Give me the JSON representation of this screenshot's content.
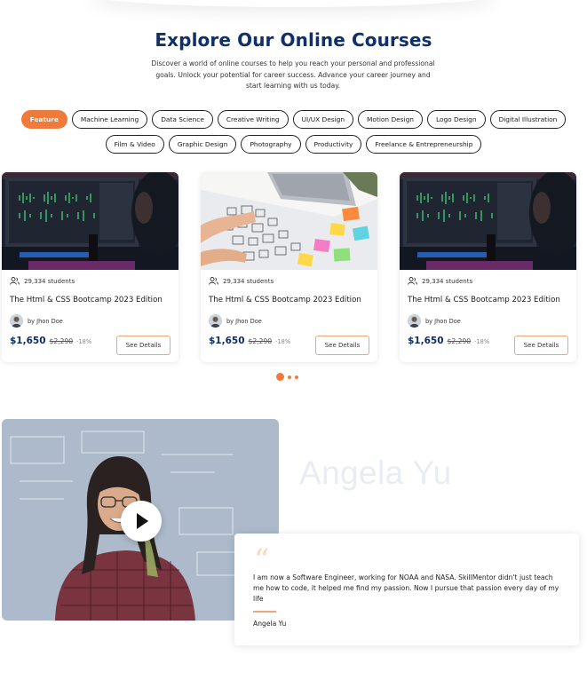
{
  "section": {
    "title": "Explore Our Online Courses",
    "subtitle": "Discover a world of online courses to help you reach your personal and professional goals. Unlock your potential for career success. Advance your career journey and start learning with us today."
  },
  "categories": {
    "row1": [
      "Feature",
      "Machine Learning",
      "Data Science",
      "Creative Writing",
      "UI/UX Design",
      "Motion Design",
      "Logo Design",
      "Digital Illustration"
    ],
    "row2": [
      "Film & Video",
      "Graphic Design",
      "Photography",
      "Productivity",
      "Freelance & Entrepreneurship"
    ],
    "active": "Feature"
  },
  "courses": [
    {
      "students": "29,334 students",
      "title": "The Html & CSS Bootcamp 2023 Edition",
      "author": "by Jhon Doe",
      "price": "$1,650",
      "old_price": "$2,290",
      "discount": "-18%",
      "button": "See Details",
      "image": "audio-editing-setup"
    },
    {
      "students": "29,334 students",
      "title": "The Html & CSS Bootcamp 2023 Edition",
      "author": "by Jhon Doe",
      "price": "$1,650",
      "old_price": "$2,290",
      "discount": "-18%",
      "button": "See Details",
      "image": "wireframe-sketches"
    },
    {
      "students": "29,334 students",
      "title": "The Html & CSS Bootcamp 2023 Edition",
      "author": "by Jhon Doe",
      "price": "$1,650",
      "old_price": "$2,290",
      "discount": "-18%",
      "button": "See Details",
      "image": "audio-editing-setup"
    }
  ],
  "carousel": {
    "pages": 3,
    "active": 0
  },
  "testimonial": {
    "name_display": "Angela Yu",
    "quote": "I am now a Software Engineer, working for NOAA and NASA. SkillMentor didn't just teach me how to code, it helped me find my passion. Now I pursue that passion every day of my life",
    "author": "Angela Yu"
  },
  "colors": {
    "accent": "#f07a3b",
    "title": "#10306b",
    "price": "#0f2c63"
  },
  "icons": {
    "students": "user-group-icon",
    "play": "play-icon",
    "quote": "quote-icon"
  }
}
